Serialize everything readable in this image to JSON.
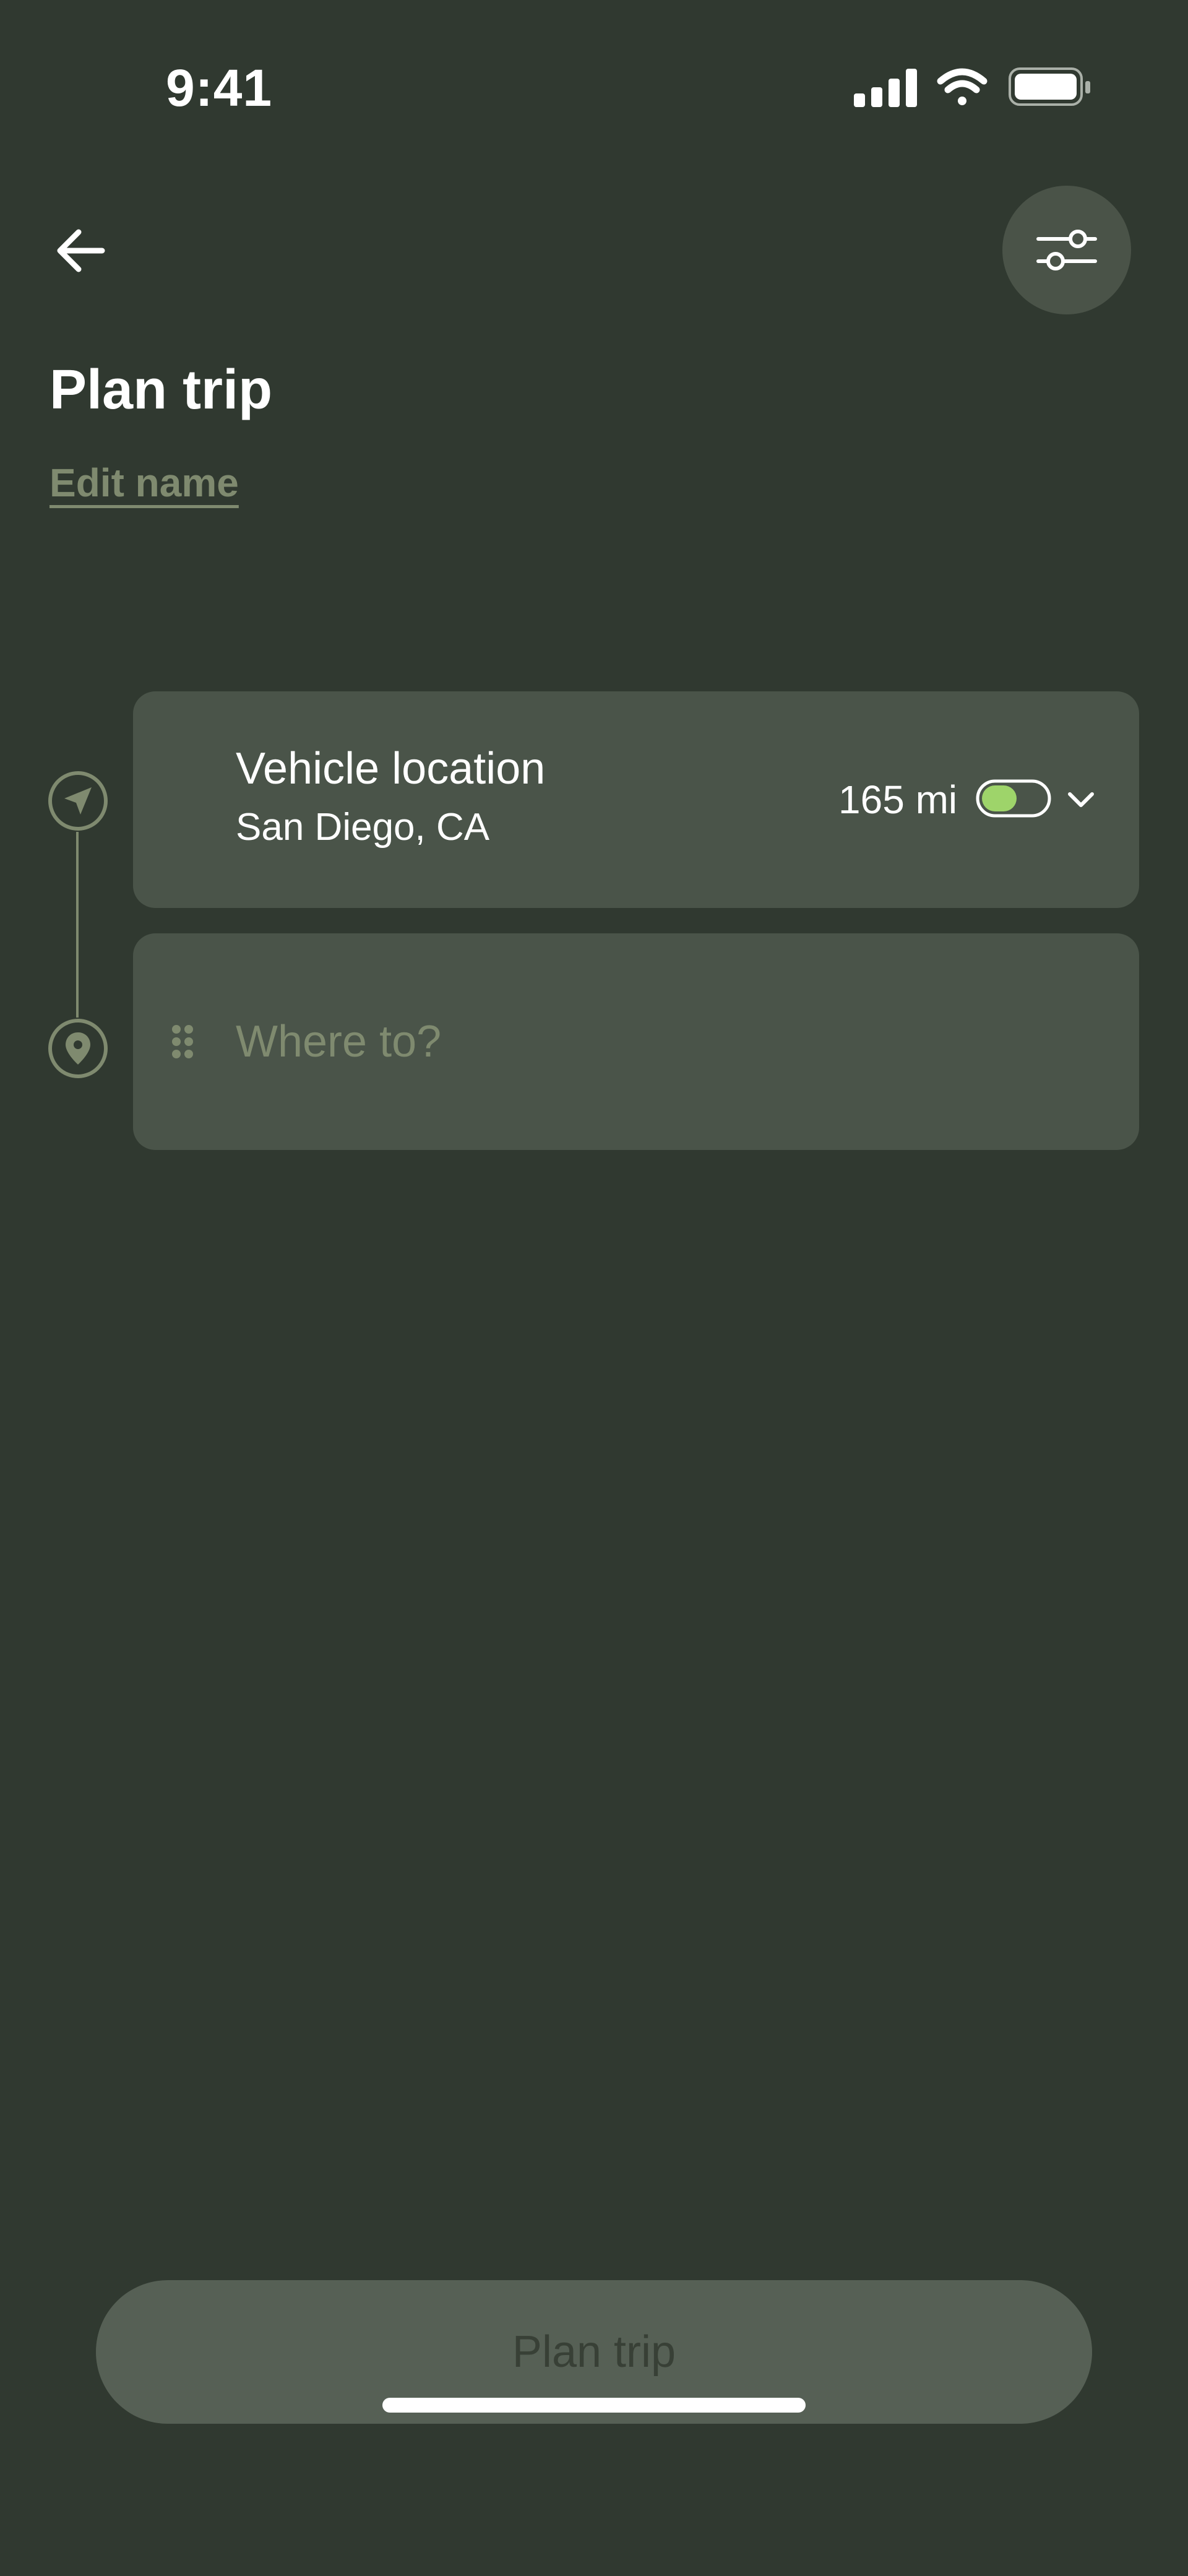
{
  "status_bar": {
    "time": "9:41",
    "icons": [
      "cellular-signal-icon",
      "wifi-icon",
      "battery-icon"
    ]
  },
  "header": {
    "back_icon": "arrow-left-icon",
    "filter_icon": "sliders-icon",
    "title": "Plan trip",
    "edit_name_link": "Edit name"
  },
  "route": {
    "start_icon": "navigation-arrow-icon",
    "end_icon": "map-pin-icon",
    "origin": {
      "title": "Vehicle location",
      "subtitle": "San Diego, CA",
      "range": "165 mi",
      "battery_level_fraction": 0.55,
      "battery_color": "#9ed46a"
    },
    "destination": {
      "placeholder": "Where to?"
    }
  },
  "footer": {
    "plan_button_label": "Plan trip"
  },
  "colors": {
    "background": "#303930",
    "card": "#4a5449",
    "muted_accent": "#7f8a6f",
    "button_disabled": "#566055"
  }
}
